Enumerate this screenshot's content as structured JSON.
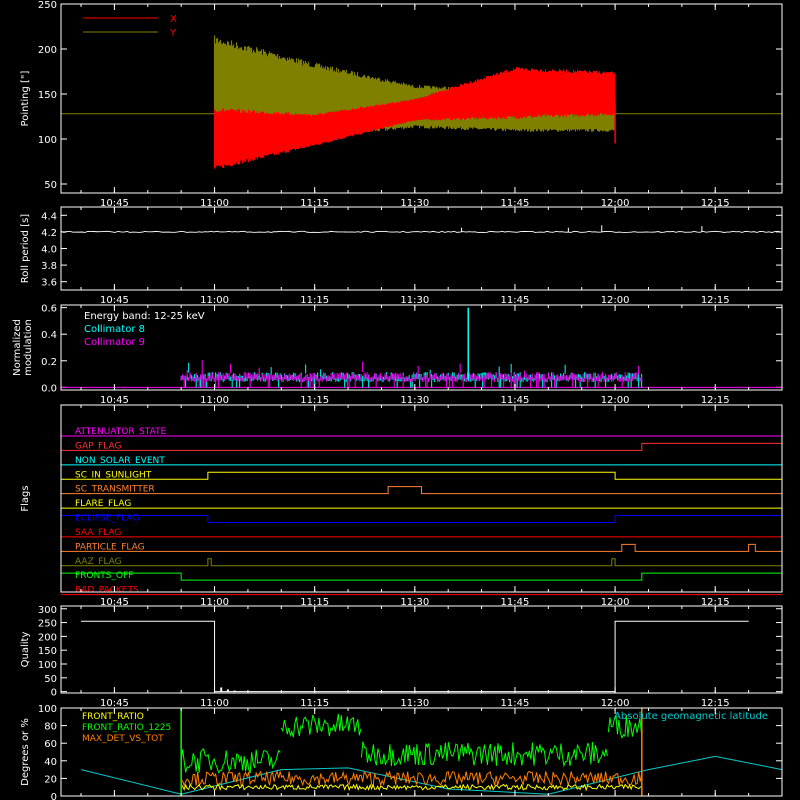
{
  "colors": {
    "background": "#000000",
    "axes": "#ffffff",
    "x_series": "#ff0000",
    "y_series": "#808000",
    "collimator8": "#00ffff",
    "collimator9": "#ff00ff",
    "front_ratio": "#ffff00",
    "front_ratio_1225": "#00ff00",
    "max_det": "#ff8000",
    "latitude": "#00cccc"
  },
  "time_ticks": [
    "10:45",
    "11:00",
    "11:15",
    "11:30",
    "11:45",
    "12:00",
    "12:15"
  ],
  "chart_data": [
    {
      "id": "pointing",
      "type": "line",
      "ylabel": "Pointing [\"]",
      "ylim": [
        40,
        250
      ],
      "yticks": [
        50,
        100,
        150,
        200,
        250
      ],
      "yticks_labels": [
        "50",
        "100",
        "150",
        "200",
        "250"
      ],
      "legend": [
        "X",
        "Y"
      ],
      "legend_placement": "top-left",
      "baseline": 128,
      "oscillation_start": "11:00",
      "oscillation_end": "12:00",
      "series": [
        {
          "name": "X",
          "color": "#ff0000",
          "envelope_points": [
            {
              "t": "11:00",
              "min": 65,
              "max": 135
            },
            {
              "t": "11:15",
              "min": 92,
              "max": 128
            },
            {
              "t": "11:30",
              "min": 120,
              "max": 145
            },
            {
              "t": "11:45",
              "min": 122,
              "max": 180
            },
            {
              "t": "12:00",
              "min": 126,
              "max": 175
            }
          ]
        },
        {
          "name": "Y",
          "color": "#808000",
          "envelope_points": [
            {
              "t": "11:00",
              "min": 90,
              "max": 215
            },
            {
              "t": "11:15",
              "min": 100,
              "max": 185
            },
            {
              "t": "11:30",
              "min": 112,
              "max": 160
            },
            {
              "t": "11:45",
              "min": 108,
              "max": 155
            },
            {
              "t": "12:00",
              "min": 108,
              "max": 150
            }
          ]
        }
      ]
    },
    {
      "id": "roll",
      "type": "line",
      "ylabel": "Roll period [s]",
      "ylim": [
        3.5,
        4.5
      ],
      "yticks": [
        3.6,
        3.8,
        4.0,
        4.2,
        4.4
      ],
      "yticks_labels": [
        "3.6",
        "3.8",
        "4.0",
        "4.2",
        "4.4"
      ],
      "baseline": 4.2,
      "spikes": [
        {
          "t": "11:37",
          "v": 4.25
        },
        {
          "t": "11:53",
          "v": 4.25
        },
        {
          "t": "11:58",
          "v": 4.28
        },
        {
          "t": "12:13",
          "v": 4.27
        }
      ]
    },
    {
      "id": "modulation",
      "type": "line",
      "ylabel": [
        "Normalized",
        "modulation"
      ],
      "ylim": [
        -0.02,
        0.62
      ],
      "yticks": [
        0.0,
        0.2,
        0.4,
        0.6
      ],
      "yticks_labels": [
        "0.0",
        "0.2",
        "0.4",
        "0.6"
      ],
      "annotation": "Energy band: 12-25 keV",
      "legend": [
        "Collimator 8",
        "Collimator 9"
      ],
      "legend_placement": "top-left",
      "range": [
        "10:55",
        "12:04"
      ],
      "typical_level": 0.09,
      "peak": {
        "t": "11:38",
        "v": 0.6
      }
    },
    {
      "id": "flags",
      "type": "line",
      "ylabel": "Flags",
      "flags": [
        {
          "name": "ATTENUATOR_STATE",
          "color": "#ff00ff",
          "transitions": []
        },
        {
          "name": "SAA_FLAG_TOP",
          "label": "GAP_FLAG",
          "color": "#ff3030",
          "transitions": [
            [
              "12:04",
              1
            ]
          ]
        },
        {
          "name": "NON_SOLAR_EVENT",
          "color": "#00ffff",
          "transitions": []
        },
        {
          "name": "SC_IN_SUNLIGHT",
          "color": "#ffff00",
          "initial": 0,
          "transitions": [
            [
              "10:59",
              1
            ],
            [
              "12:00",
              0
            ]
          ]
        },
        {
          "name": "SC_TRANSMITTER",
          "color": "#ff8030",
          "initial": 0,
          "transitions": [
            [
              "11:26",
              1
            ],
            [
              "11:31",
              0
            ]
          ]
        },
        {
          "name": "FLARE_FLAG",
          "color": "#ffff00",
          "transitions": []
        },
        {
          "name": "ECLIPSE_FLAG",
          "color": "#0000ff",
          "initial": 1,
          "transitions": [
            [
              "10:59",
              0
            ],
            [
              "12:00",
              1
            ]
          ]
        },
        {
          "name": "SAA_FLAG",
          "color": "#ff0000",
          "transitions": []
        },
        {
          "name": "PARTICLE_FLAG",
          "color": "#ff8030",
          "initial": 0,
          "transitions": [
            [
              "12:01",
              1
            ],
            [
              "12:03",
              0
            ],
            [
              "12:20",
              1
            ],
            [
              "12:21",
              0
            ]
          ]
        },
        {
          "name": "AAZ_FLAG",
          "color": "#808000",
          "initial": 0,
          "transitions": [
            [
              "10:59",
              1
            ],
            [
              "10:59.5",
              0
            ],
            [
              "11:59.5",
              1
            ],
            [
              "12:00",
              0
            ]
          ]
        },
        {
          "name": "FRONTS_OFF",
          "color": "#00ff00",
          "initial": 1,
          "transitions": [
            [
              "10:55",
              0
            ],
            [
              "12:04",
              1
            ]
          ]
        },
        {
          "name": "BAD_PACKETS",
          "color": "#ff0000",
          "transitions": []
        }
      ],
      "flag_labels": [
        "ATTENUATOR_STATE",
        "GAP_FLAG",
        "NON_SOLAR_EVENT",
        "SC_IN_SUNLIGHT",
        "SC_TRANSMITTER",
        "FLARE_FLAG",
        "ECLIPSE_FLAG",
        "SAA_FLAG",
        "PARTICLE_FLAG",
        "AAZ_FLAG",
        "FRONTS_OFF",
        "BAD_PACKETS"
      ]
    },
    {
      "id": "quality",
      "type": "line",
      "ylabel": "Quality",
      "ylim": [
        -5,
        310
      ],
      "yticks": [
        0,
        50,
        100,
        150,
        200,
        250,
        300
      ],
      "yticks_labels": [
        "0",
        "50",
        "100",
        "150",
        "200",
        "250",
        "300"
      ],
      "segments": [
        {
          "from": "10:40",
          "to": "11:00",
          "v": 255
        },
        {
          "from": "11:00",
          "to": "12:00",
          "v": 0
        },
        {
          "from": "12:00",
          "to": "12:20",
          "v": 255
        }
      ],
      "bumps": [
        {
          "t": "11:01",
          "v": 15
        },
        {
          "t": "11:02",
          "v": 8
        },
        {
          "t": "11:03",
          "v": 4
        }
      ]
    },
    {
      "id": "front",
      "type": "line",
      "ylabel": "Degrees or %",
      "ylim": [
        0,
        100
      ],
      "yticks": [
        0,
        20,
        40,
        60,
        80,
        100
      ],
      "yticks_labels": [
        "0",
        "20",
        "40",
        "60",
        "80",
        "100"
      ],
      "legend": [
        "FRONT_RATIO",
        "FRONT_RATIO_1225",
        "MAX_DET_VS_TOT"
      ],
      "legend_placement": "top-left",
      "right_label": "Absolute geomagnetic latitude",
      "series": [
        {
          "name": "FRONT_RATIO",
          "color": "#ffff00",
          "level": 10,
          "range": [
            "10:55",
            "12:04"
          ]
        },
        {
          "name": "FRONT_RATIO_1225",
          "color": "#00ff00",
          "segments": [
            {
              "from": "10:55",
              "to": "11:10",
              "level": 40
            },
            {
              "from": "11:10",
              "to": "11:22",
              "level": 80
            },
            {
              "from": "11:22",
              "to": "11:59",
              "level": 48
            },
            {
              "from": "11:59",
              "to": "12:04",
              "level": 80
            }
          ]
        },
        {
          "name": "MAX_DET_VS_TOT",
          "color": "#ff8000",
          "level": 20,
          "range": [
            "10:55",
            "12:04"
          ]
        },
        {
          "name": "Absolute geomagnetic latitude",
          "color": "#00cccc",
          "points": [
            [
              "10:40",
              30
            ],
            [
              "10:55",
              2
            ],
            [
              "11:10",
              30
            ],
            [
              "11:20",
              32
            ],
            [
              "11:35",
              8
            ],
            [
              "11:50",
              2
            ],
            [
              "12:05",
              30
            ],
            [
              "12:15",
              45
            ],
            [
              "12:25",
              30
            ]
          ]
        }
      ]
    }
  ]
}
